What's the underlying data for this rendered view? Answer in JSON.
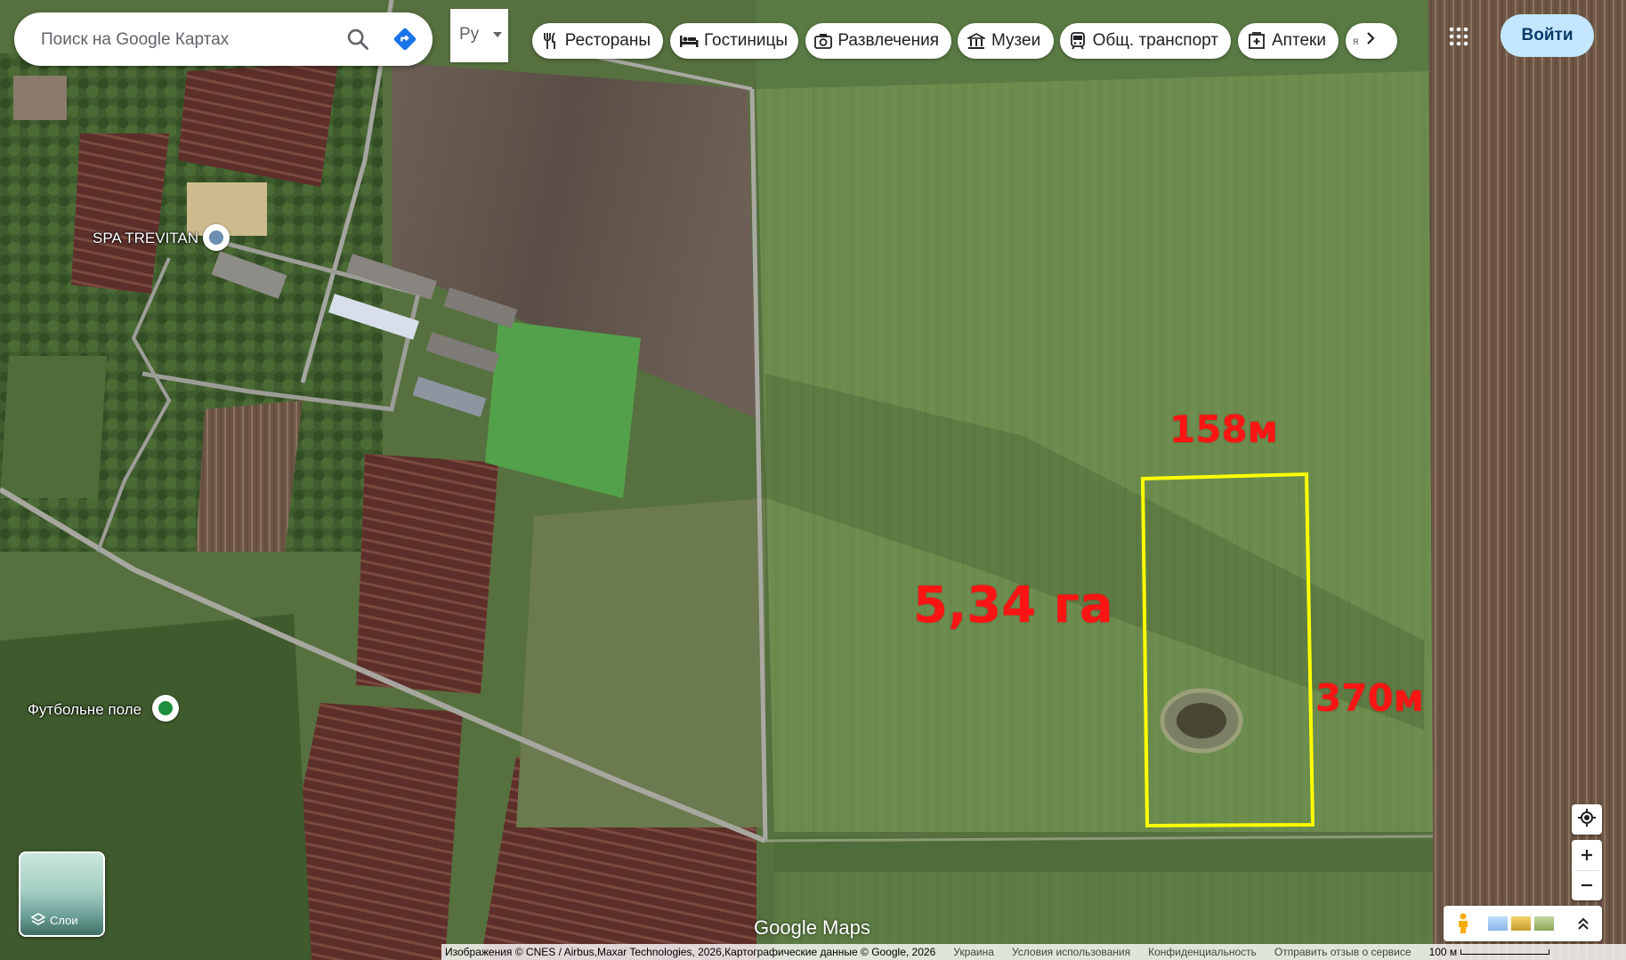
{
  "search": {
    "placeholder": "Поиск на Google Картах"
  },
  "language": {
    "selected": "Ру"
  },
  "categories": [
    {
      "label": "Рестораны",
      "icon": "restaurant-icon"
    },
    {
      "label": "Гостиницы",
      "icon": "hotel-icon"
    },
    {
      "label": "Развлечения",
      "icon": "camera-icon"
    },
    {
      "label": "Музеи",
      "icon": "museum-icon"
    },
    {
      "label": "Общ. транспорт",
      "icon": "transit-icon"
    },
    {
      "label": "Аптеки",
      "icon": "pharmacy-icon"
    }
  ],
  "categories_more_label": "я",
  "signin_label": "Войти",
  "places": [
    {
      "name": "SPA TREVITAN",
      "color": "#6d8fb0"
    },
    {
      "name": "Футбольне поле",
      "color": "#1e8e3e"
    }
  ],
  "annotations": {
    "area": "5,34 га",
    "width": "158м",
    "length": "370м",
    "outline_color": "#ffff00",
    "text_color": "#ff1414"
  },
  "layers_label": "Слои",
  "brand": "Google Maps",
  "footer": {
    "attribution": "Изображения © CNES / Airbus,Maxar Technologies, 2026,Картографические данные © Google, 2026",
    "country": "Украина",
    "terms": "Условия использования",
    "privacy": "Конфиденциальность",
    "feedback": "Отправить отзыв о сервисе",
    "scale": "100 м"
  }
}
